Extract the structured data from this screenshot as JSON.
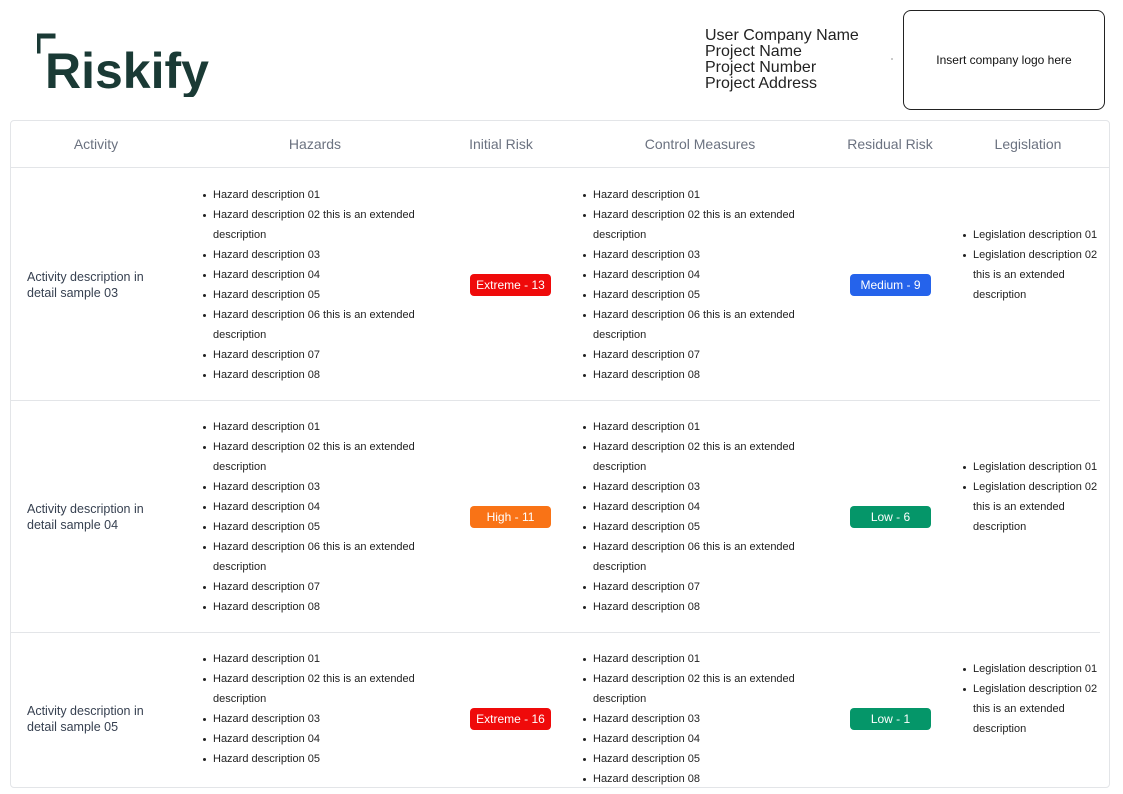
{
  "brand": {
    "name": "Riskify",
    "color": "#1a3a35"
  },
  "project": {
    "company": "User Company Name",
    "name": "Project Name",
    "number": "Project Number",
    "address": "Project Address"
  },
  "logo_placeholder": "Insert company logo here",
  "table": {
    "headers": [
      "Activity",
      "Hazards",
      "Initial Risk",
      "Control Measures",
      "Residual Risk",
      "Legislation"
    ],
    "rows": [
      {
        "activity": "Activity description in detail sample 03",
        "hazards": [
          "Hazard description 01",
          "Hazard description 02 this is an extended description",
          "Hazard description 03",
          "Hazard description 04",
          "Hazard description 05",
          "Hazard description 06 this is an extended description",
          "Hazard description 07",
          "Hazard description 08"
        ],
        "initial_risk": {
          "label": "Extreme - 13",
          "color": "#ef0a0a"
        },
        "controls": [
          "Hazard description 01",
          "Hazard description 02 this is an extended description",
          "Hazard description 03",
          "Hazard description 04",
          "Hazard description 05",
          "Hazard description 06 this is an extended description",
          "Hazard description 07",
          "Hazard description 08"
        ],
        "residual_risk": {
          "label": "Medium - 9",
          "color": "#2563eb"
        },
        "legislation": [
          "Legislation description 01",
          "Legislation description 02 this is an extended description"
        ]
      },
      {
        "activity": "Activity description in detail sample 04",
        "hazards": [
          "Hazard description 01",
          "Hazard description 02 this is an extended description",
          "Hazard description 03",
          "Hazard description 04",
          "Hazard description 05",
          "Hazard description 06 this is an extended description",
          "Hazard description 07",
          "Hazard description 08"
        ],
        "initial_risk": {
          "label": "High - 11",
          "color": "#f97316"
        },
        "controls": [
          "Hazard description 01",
          "Hazard description 02 this is an extended description",
          "Hazard description 03",
          "Hazard description 04",
          "Hazard description 05",
          "Hazard description 06 this is an extended description",
          "Hazard description 07",
          "Hazard description 08"
        ],
        "residual_risk": {
          "label": "Low - 6",
          "color": "#059669"
        },
        "legislation": [
          "Legislation description 01",
          "Legislation description 02 this is an extended description"
        ]
      },
      {
        "activity": "Activity description in detail sample 05",
        "hazards": [
          "Hazard description 01",
          "Hazard description 02 this is an extended description",
          "Hazard description 03",
          "Hazard description 04",
          "Hazard description 05"
        ],
        "initial_risk": {
          "label": "Extreme - 16",
          "color": "#ef0a0a"
        },
        "controls": [
          "Hazard description 01",
          "Hazard description 02 this is an extended description",
          "Hazard description 03",
          "Hazard description 04",
          "Hazard description 05",
          "Hazard description 08"
        ],
        "residual_risk": {
          "label": "Low - 1",
          "color": "#059669"
        },
        "legislation": [
          "Legislation description 01",
          "Legislation description 02 this is an extended description"
        ]
      }
    ]
  }
}
